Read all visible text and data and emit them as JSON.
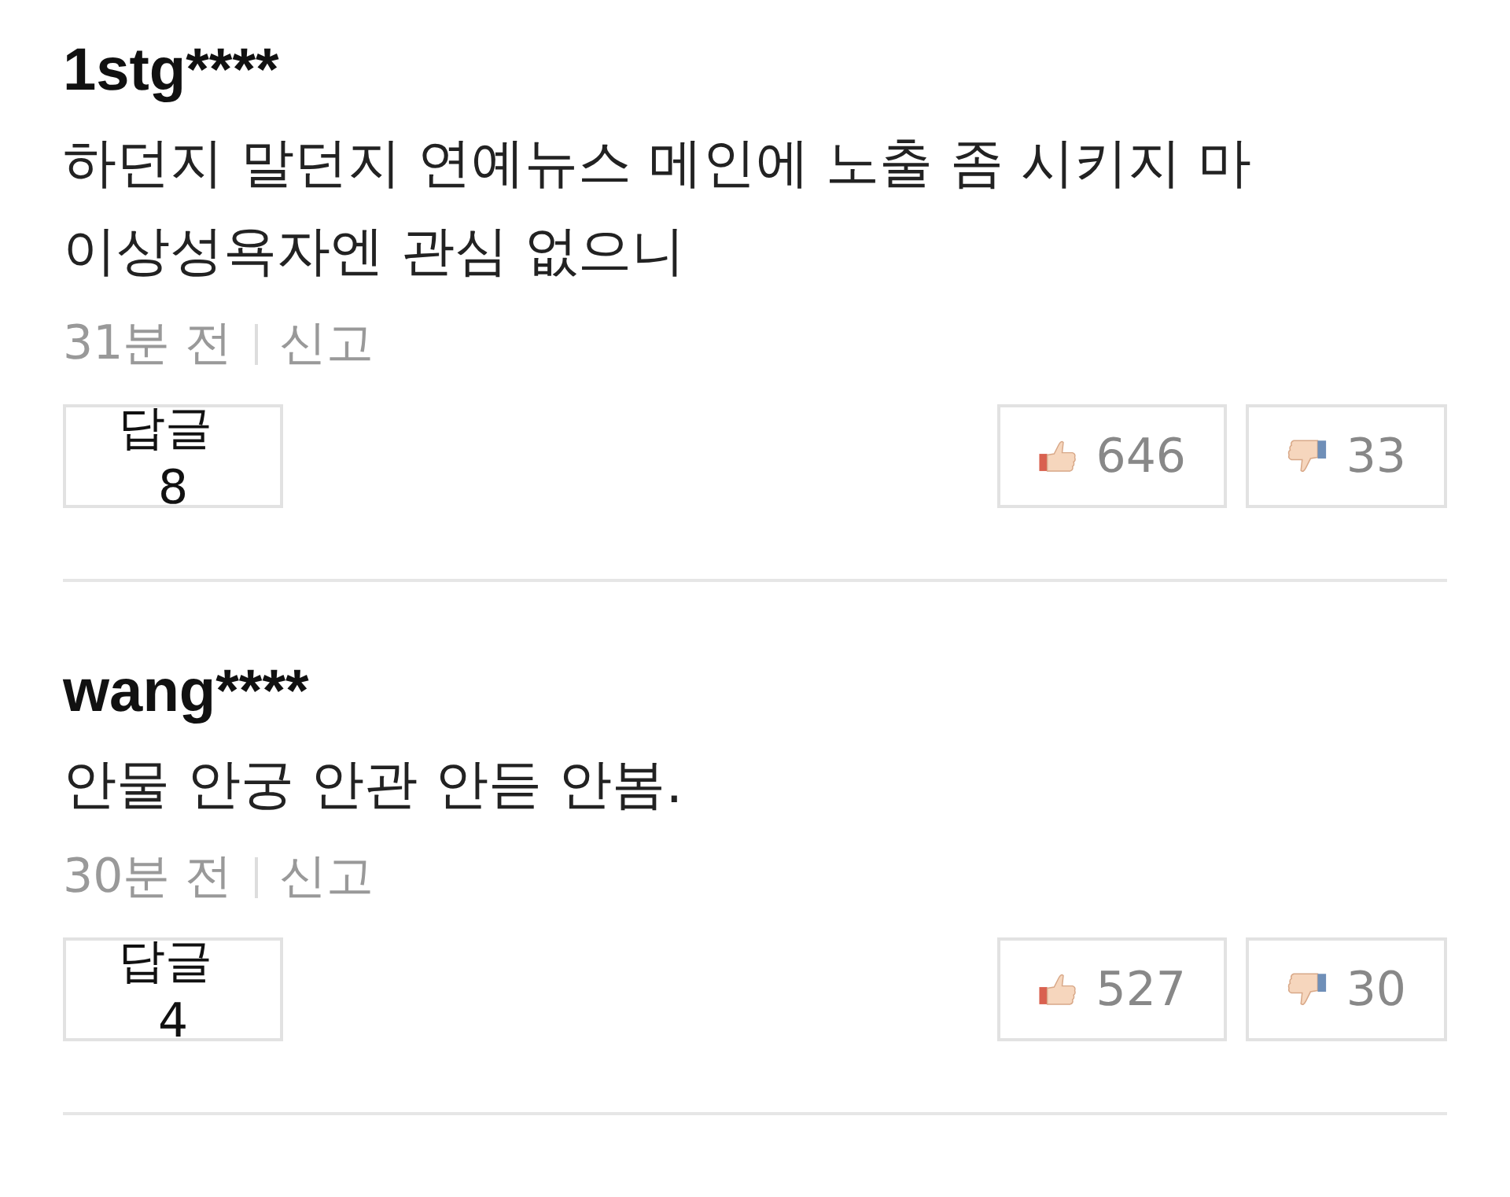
{
  "comments": [
    {
      "username": "1stg****",
      "text": "하던지 말던지 연예뉴스 메인에 노출 좀 시키지 마\n이상성욕자엔 관심 없으니",
      "time": "31분 전",
      "report": "신고",
      "reply_label": "답글",
      "reply_count": "8",
      "likes": "646",
      "dislikes": "33"
    },
    {
      "username": "wang****",
      "text": "안물 안궁 안관 안듣 안봄.",
      "time": "30분 전",
      "report": "신고",
      "reply_label": "답글",
      "reply_count": "4",
      "likes": "527",
      "dislikes": "30"
    }
  ]
}
